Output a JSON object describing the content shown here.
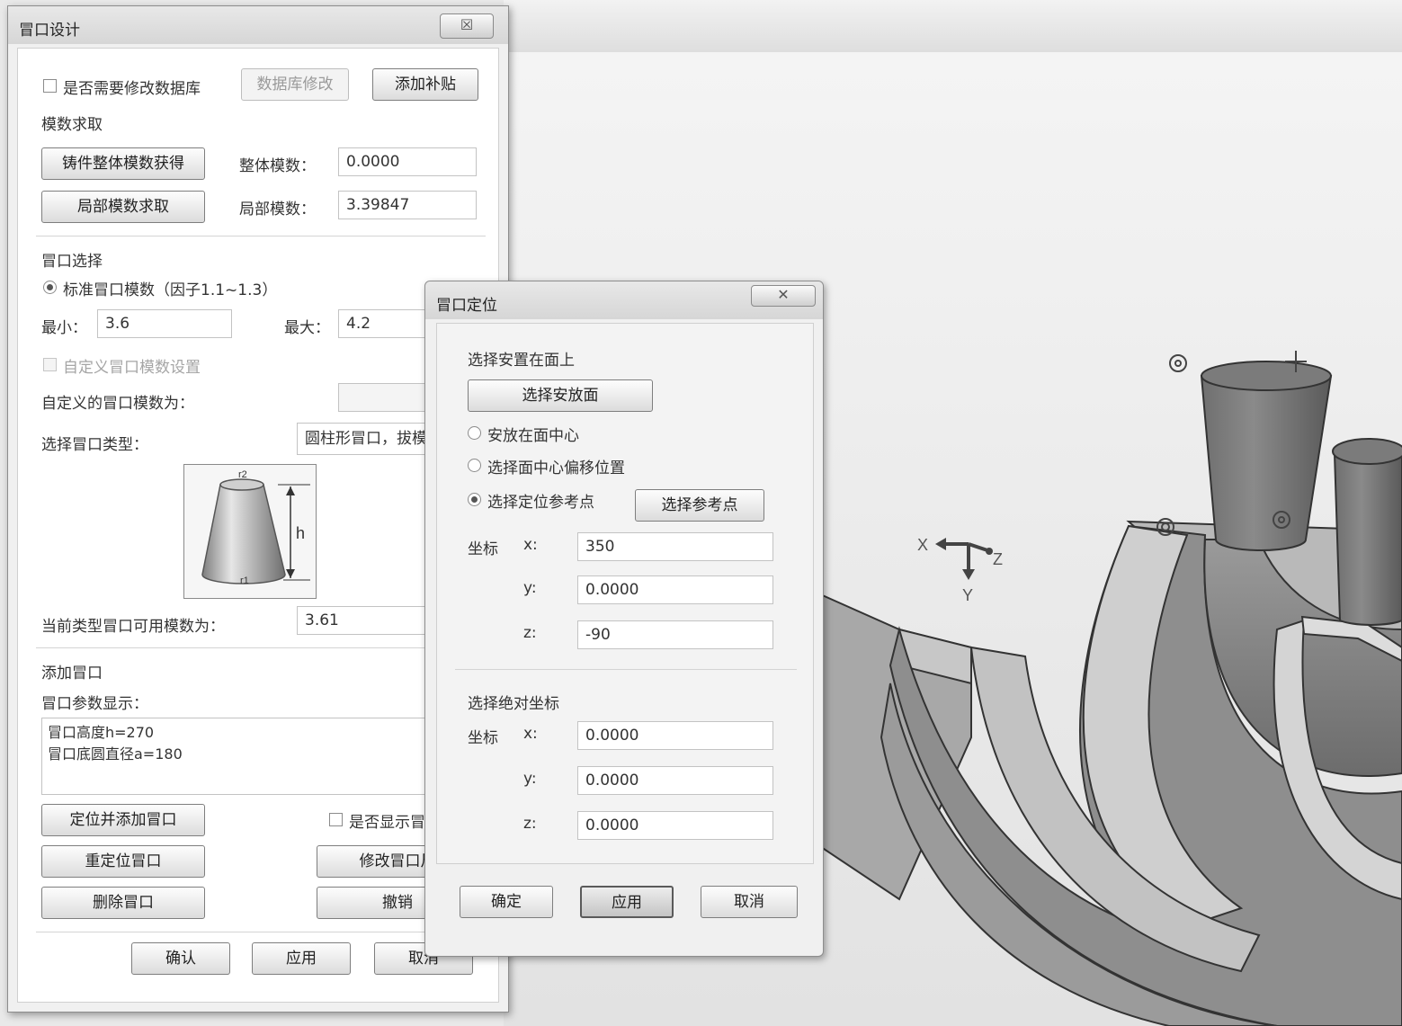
{
  "riser_design": {
    "title": "冒口设计",
    "close_symbol": "☒",
    "modify_db_checkbox": "是否需要修改数据库",
    "db_modify_button": "数据库修改",
    "add_patch_button": "添加补贴",
    "modulus_section": "模数求取",
    "whole_modulus_button": "铸件整体模数获得",
    "whole_modulus_label": "整体模数：",
    "whole_modulus_value": "0.0000",
    "local_modulus_button": "局部模数求取",
    "local_modulus_label": "局部模数：",
    "local_modulus_value": "3.39847",
    "riser_select_section": "冒口选择",
    "standard_modulus_radio": "标准冒口模数（因子1.1~1.3）",
    "min_label": "最小：",
    "min_value": "3.6",
    "max_label": "最大：",
    "max_value": "4.2",
    "custom_modulus_checkbox": "自定义冒口模数设置",
    "custom_modulus_label": "自定义的冒口模数为：",
    "riser_type_label": "选择冒口类型：",
    "riser_type_value": "圆柱形冒口，拔模",
    "diagram_h": "h",
    "diagram_r1": "r1",
    "diagram_r2": "r2",
    "available_modulus_label": "当前类型冒口可用模数为：",
    "available_modulus_value": "3.61",
    "add_riser_section": "添加冒口",
    "param_display_label": "冒口参数显示：",
    "param_line1": "冒口高度h=270",
    "param_line2": "冒口底圆直径a=180",
    "locate_add_button": "定位并添加冒口",
    "show_checkbox": "是否显示冒",
    "relocate_button": "重定位冒口",
    "modify_size_button": "修改冒口尺",
    "delete_button": "删除冒口",
    "undo_button": "撤销",
    "confirm_button": "确认",
    "apply_button": "应用",
    "cancel_button": "取消"
  },
  "riser_position": {
    "title": "冒口定位",
    "close_symbol": "✕",
    "place_on_face_section": "选择安置在面上",
    "select_face_button": "选择安放面",
    "radio_center": "安放在面中心",
    "radio_offset": "选择面中心偏移位置",
    "radio_refpoint": "选择定位参考点",
    "select_refpoint_button": "选择参考点",
    "coord_label": "坐标",
    "x_label": "x:",
    "y_label": "y:",
    "z_label": "z:",
    "x_value": "350",
    "y_value": "0.0000",
    "z_value": "-90",
    "absolute_section": "选择绝对坐标",
    "abs_coord_label": "坐标",
    "abs_x_value": "0.0000",
    "abs_y_value": "0.0000",
    "abs_z_value": "0.0000",
    "ok_button": "确定",
    "apply_button": "应用",
    "cancel_button": "取消"
  },
  "viewport": {
    "axis_x": "X",
    "axis_y": "Y",
    "axis_z": "Z"
  }
}
